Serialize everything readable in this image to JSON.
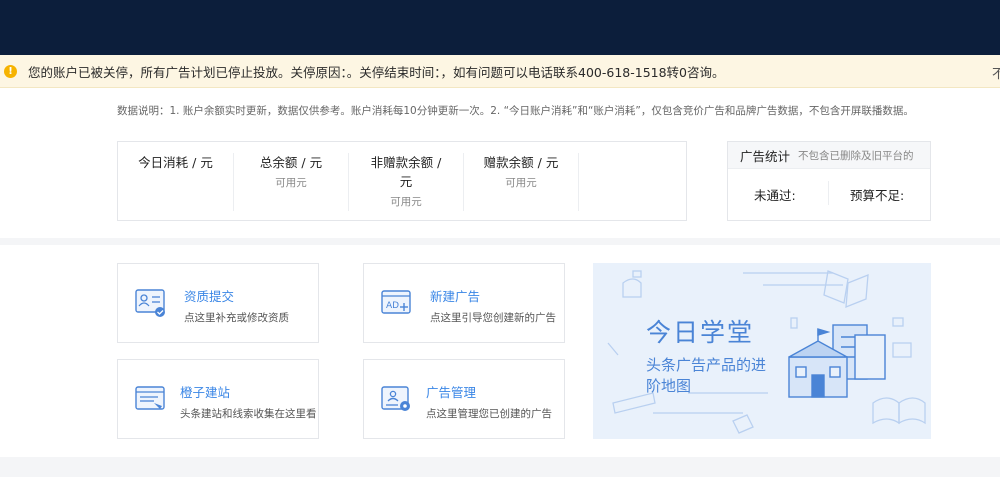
{
  "notice": {
    "message": "您的账户已被关停，所有广告计划已停止投放。关停原因：。关停结束时间：，如有问题可以电话联系400-618-1518转0咨询。",
    "close": "不"
  },
  "data_description": "数据说明：1. 账户余额实时更新，数据仅供参考。账户消耗每10分钟更新一次。2. “今日账户消耗”和“账户消耗”，仅包含竞价广告和品牌广告数据，不包含开屏联播数据。",
  "balances": [
    {
      "title": "今日消耗 / 元",
      "sub": ""
    },
    {
      "title": "总余额 / 元",
      "sub": "可用元"
    },
    {
      "title": "非赠款余额 / 元",
      "sub": "可用元"
    },
    {
      "title": "赠款余额 / 元",
      "sub": "可用元"
    }
  ],
  "ad_stats": {
    "title": "广告统计",
    "note": "不包含已删除及旧平台的",
    "not_passed": "未通过:",
    "budget_short": "预算不足:"
  },
  "tiles": [
    {
      "title": "资质提交",
      "sub": "点这里补充或修改资质",
      "icon": "id-card-icon"
    },
    {
      "title": "新建广告",
      "sub": "点这里引导您创建新的广告",
      "icon": "new-ad-icon"
    },
    {
      "title": "橙子建站",
      "sub": "头条建站和线索收集在这里看",
      "icon": "site-builder-icon"
    },
    {
      "title": "广告管理",
      "sub": "点这里管理您已创建的广告",
      "icon": "ad-manage-icon"
    }
  ],
  "banner": {
    "title": "今日学堂",
    "subtitle": "头条广告产品的进阶地图"
  },
  "colors": {
    "topbar": "#0c1e3b",
    "accent": "#3a86e6",
    "notice_bg": "#fdf6e3",
    "warning": "#f6b300"
  }
}
